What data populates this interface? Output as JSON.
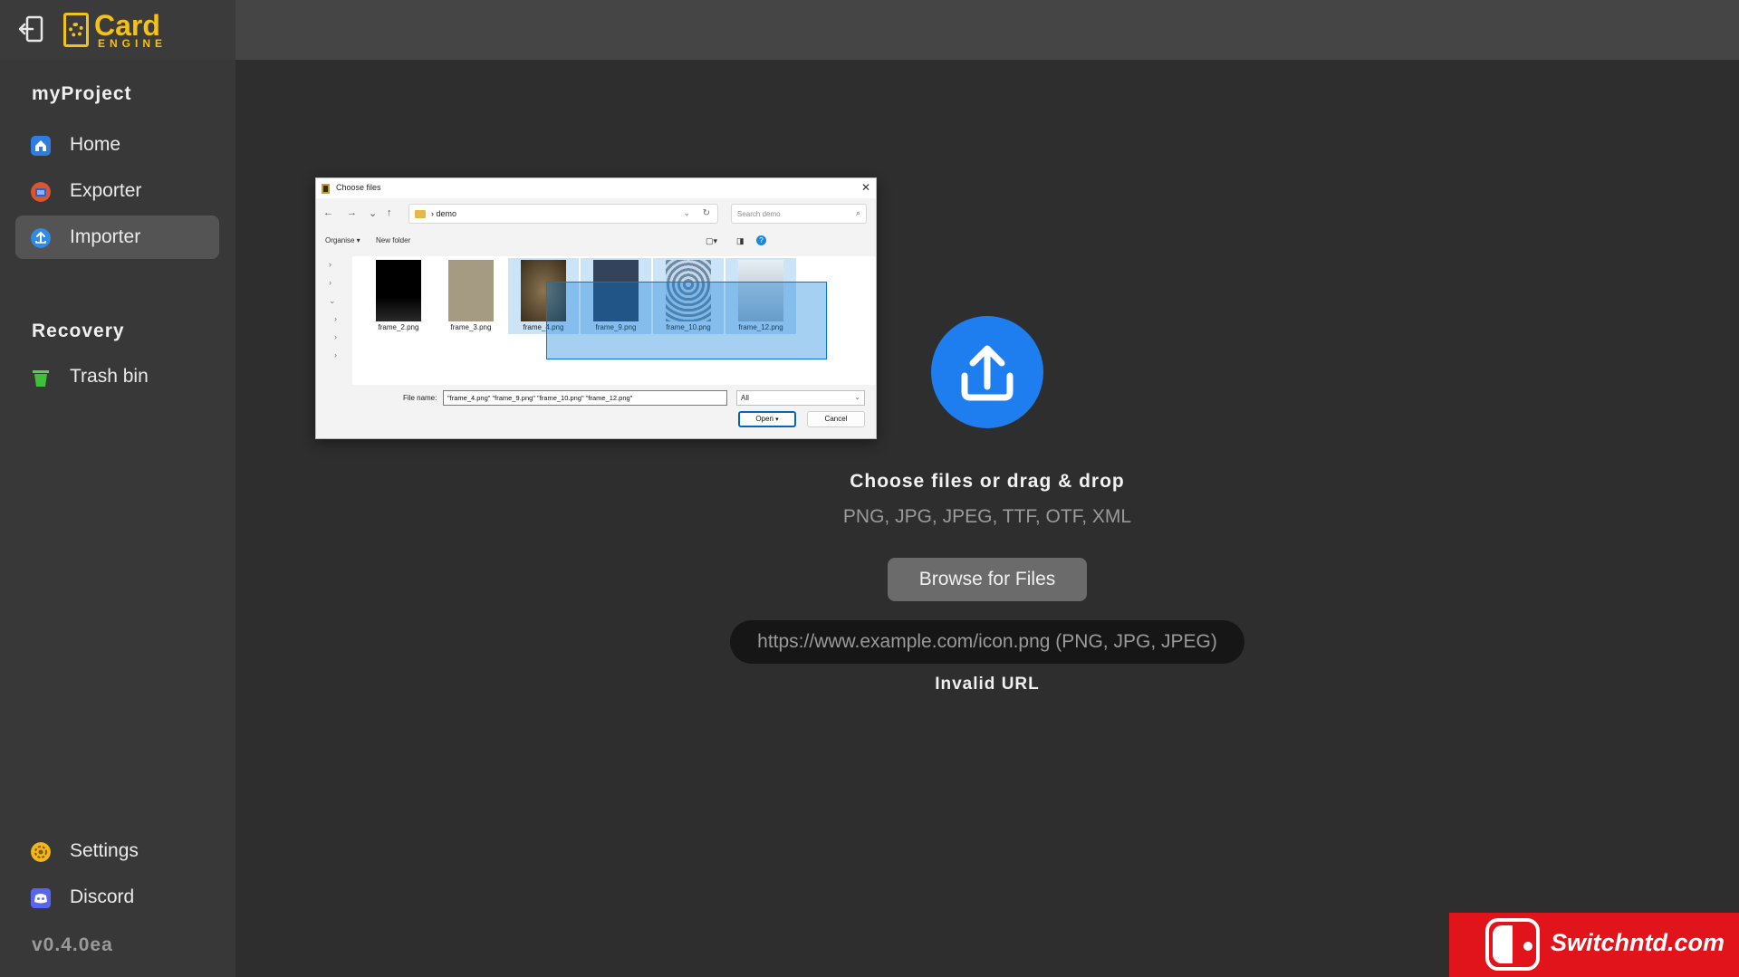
{
  "app": {
    "logo_title": "Card",
    "logo_subtitle": "ENGINE"
  },
  "sidebar": {
    "project_title": "myProject",
    "items": [
      {
        "label": "Home",
        "icon": "home-icon",
        "color": "#2f7de1"
      },
      {
        "label": "Exporter",
        "icon": "exporter-icon",
        "color": "#e0542b"
      },
      {
        "label": "Importer",
        "icon": "importer-icon",
        "color": "#2f8ae8",
        "active": true
      }
    ],
    "recovery_title": "Recovery",
    "recovery_items": [
      {
        "label": "Trash bin",
        "icon": "trash-icon",
        "color": "#3fbf3a"
      }
    ],
    "bottom_items": [
      {
        "label": "Settings",
        "icon": "settings-icon",
        "color": "#f0b81c"
      },
      {
        "label": "Discord",
        "icon": "discord-icon",
        "color": "#5865f2"
      }
    ],
    "version": "v0.4.0ea"
  },
  "main": {
    "drop_title": "Choose files or drag & drop",
    "drop_types": "PNG, JPG, JPEG, TTF, OTF, XML",
    "browse_label": "Browse for Files",
    "url_placeholder": "https://www.example.com/icon.png (PNG, JPG, JPEG)",
    "url_error": "Invalid URL"
  },
  "dialog": {
    "title": "Choose files",
    "breadcrumb": "demo",
    "search_placeholder": "Search demo",
    "organise": "Organise ▾",
    "new_folder": "New folder",
    "files": [
      {
        "name": "frame_2.png",
        "selected": false,
        "color": "#0a0a0a"
      },
      {
        "name": "frame_3.png",
        "selected": false,
        "color": "#a59a82"
      },
      {
        "name": "frame_4.png",
        "selected": true,
        "color": "#6b5a3e"
      },
      {
        "name": "frame_9.png",
        "selected": true,
        "color": "#3a4c6a"
      },
      {
        "name": "frame_10.png",
        "selected": true,
        "color": "#8fa8c2"
      },
      {
        "name": "frame_12.png",
        "selected": true,
        "color": "#b8c2cc"
      }
    ],
    "file_name_label": "File name:",
    "file_name_value": "\"frame_4.png\" \"frame_9.png\" \"frame_10.png\" \"frame_12.png\"",
    "file_type": "All",
    "open_label": "Open",
    "cancel_label": "Cancel"
  },
  "watermark": {
    "text": "Switchntd.com"
  }
}
